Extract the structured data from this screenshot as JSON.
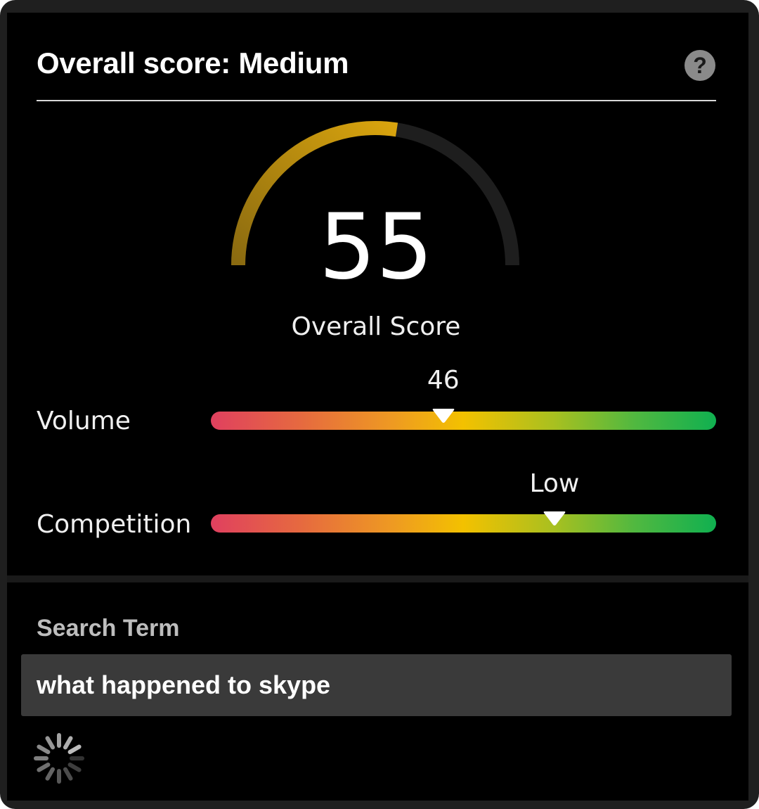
{
  "header": {
    "title": "Overall score: Medium",
    "help_icon": "question-mark-icon"
  },
  "gauge": {
    "value": 55,
    "max": 100,
    "label": "Overall Score",
    "fill_color": "#c8960c",
    "track_color": "#1e1e1e"
  },
  "metrics": [
    {
      "name": "Volume",
      "display": "46",
      "level": 0.46
    },
    {
      "name": "Competition",
      "display": "Low",
      "level": 0.68
    }
  ],
  "search": {
    "label": "Search Term",
    "value": "what happened to skype",
    "loading_icon": "spinner-icon"
  },
  "colors": {
    "scale_low": "#e0405f",
    "scale_mid": "#f3c100",
    "scale_high": "#10b050"
  }
}
